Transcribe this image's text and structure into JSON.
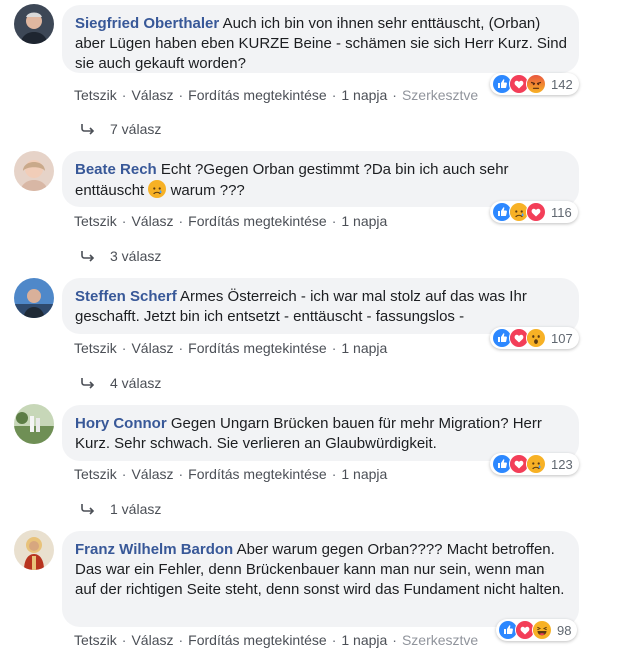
{
  "comments": [
    {
      "author": "Siegfried Oberthaler",
      "text": "Auch ich bin von ihnen sehr enttäuscht, (Orban) aber Lügen haben eben KURZE Beine - schämen sie sich Herr Kurz. Sind sie auch gekauft worden?",
      "reactions": [
        "like",
        "love",
        "angry"
      ],
      "reaction_count": "142",
      "actions": {
        "like": "Tetszik",
        "reply": "Válasz",
        "translate": "Fordítás megtekintése",
        "time": "1 napja",
        "edited": "Szerkesztve"
      },
      "replies": "7 válasz"
    },
    {
      "author": "Beate Rech",
      "text_before": "Echt ?Gegen Orban gestimmt ?Da bin ich auch sehr enttäuscht",
      "text_after": "warum ???",
      "reactions": [
        "like",
        "sad",
        "love"
      ],
      "reaction_count": "116",
      "actions": {
        "like": "Tetszik",
        "reply": "Válasz",
        "translate": "Fordítás megtekintése",
        "time": "1 napja"
      },
      "replies": "3 válasz"
    },
    {
      "author": "Steffen Scherf",
      "text": "Armes Österreich - ich war mal stolz auf das was Ihr geschafft. Jetzt bin ich entsetzt - enttäuscht - fassungslos -",
      "reactions": [
        "like",
        "love",
        "wow"
      ],
      "reaction_count": "107",
      "actions": {
        "like": "Tetszik",
        "reply": "Válasz",
        "translate": "Fordítás megtekintése",
        "time": "1 napja"
      },
      "replies": "4 válasz"
    },
    {
      "author": "Hory Connor",
      "text": "Gegen Ungarn Brücken bauen für mehr Migration? Herr Kurz. Sehr schwach. Sie verlieren an Glaubwürdigkeit.",
      "reactions": [
        "like",
        "love",
        "sad"
      ],
      "reaction_count": "123",
      "actions": {
        "like": "Tetszik",
        "reply": "Válasz",
        "translate": "Fordítás megtekintése",
        "time": "1 napja"
      },
      "replies": "1 válasz"
    },
    {
      "author": "Franz Wilhelm Bardon",
      "text": "Aber warum gegen Orban???? Macht betroffen. Das war ein Fehler, denn Brückenbauer kann man nur sein, wenn man auf der richtigen Seite steht, denn sonst wird das Fundament nicht halten.",
      "reactions": [
        "like",
        "love",
        "haha"
      ],
      "reaction_count": "98",
      "actions": {
        "like": "Tetszik",
        "reply": "Válasz",
        "translate": "Fordítás megtekintése",
        "time": "1 napja",
        "edited": "Szerkesztve"
      }
    }
  ],
  "colors": {
    "link": "#385898",
    "bubble": "#f2f3f5",
    "meta": "#606770",
    "like": "#2d88ff",
    "love": "#f33e58",
    "emoji": "#f7b125"
  }
}
